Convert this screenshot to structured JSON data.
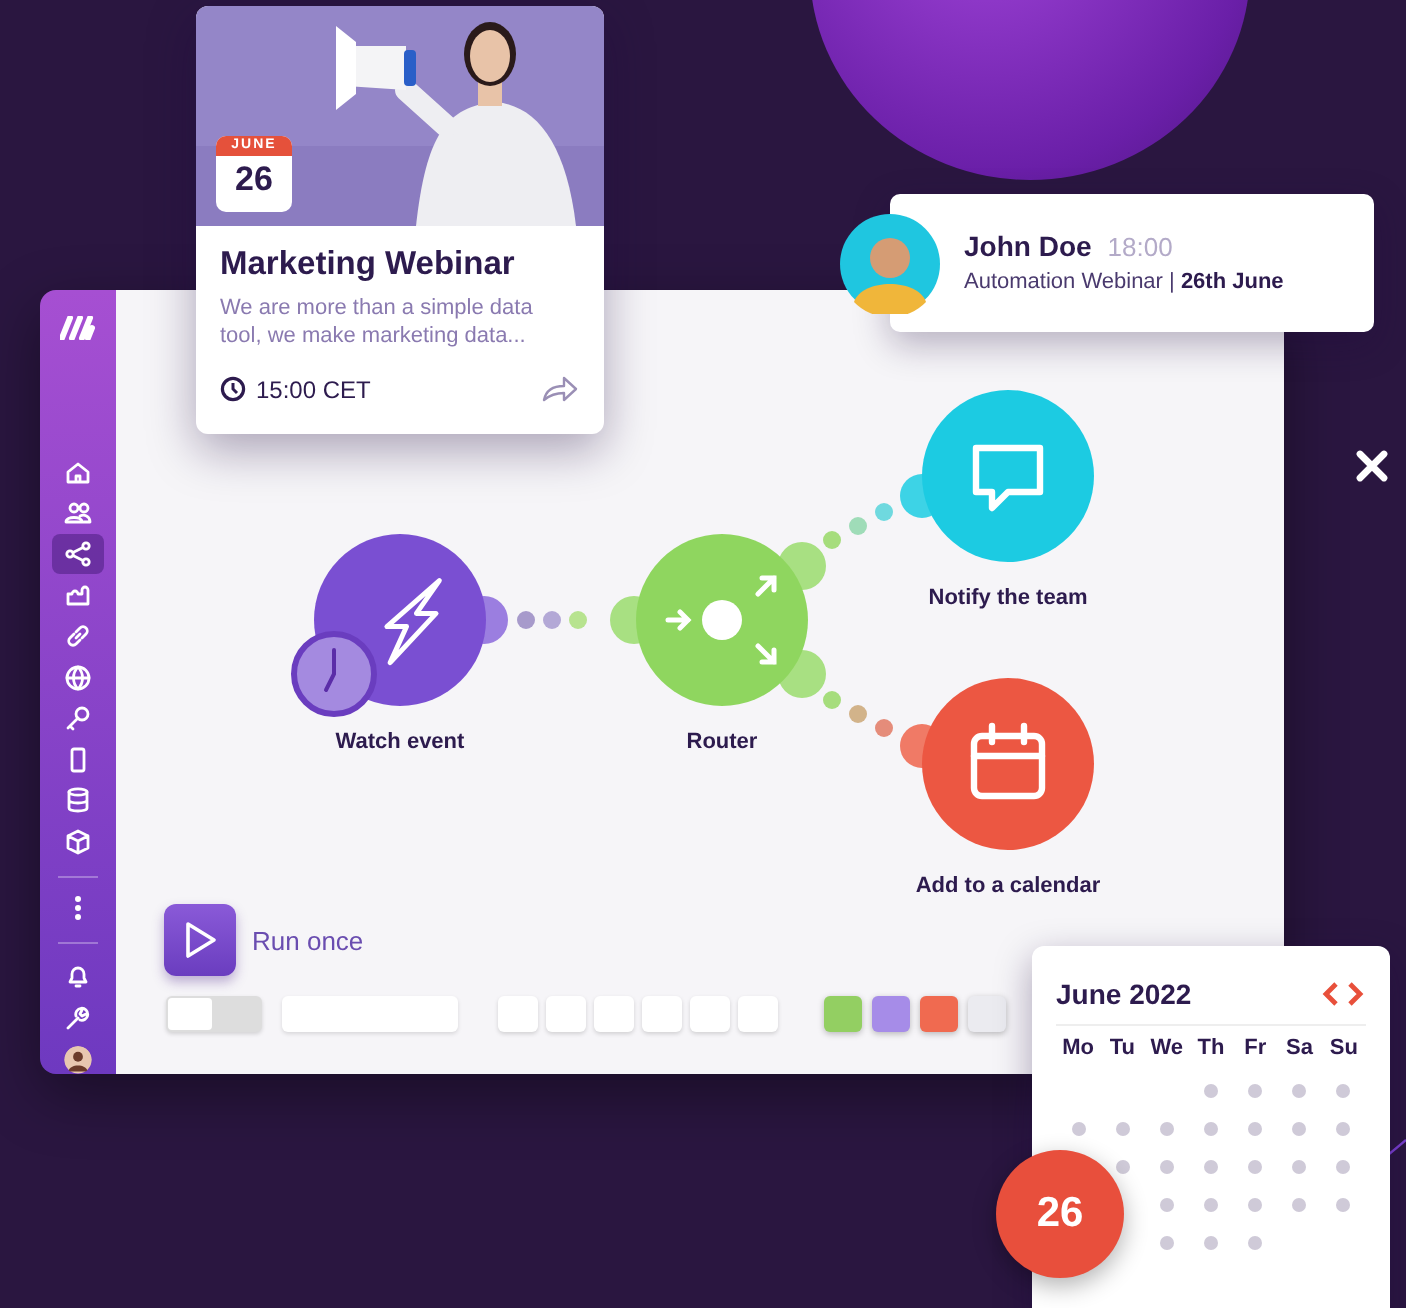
{
  "sidebar": {
    "items": [
      {
        "selected": false
      },
      {
        "selected": false
      },
      {
        "selected": true
      },
      {
        "selected": false
      },
      {
        "selected": false
      },
      {
        "selected": false
      },
      {
        "selected": false
      },
      {
        "selected": false
      },
      {
        "selected": false
      },
      {
        "selected": false
      },
      {
        "selected": false
      },
      {
        "selected": false
      },
      {
        "selected": false
      }
    ]
  },
  "event_card": {
    "month": "JUNE",
    "day": "26",
    "title": "Marketing Webinar",
    "description": "We are more than a simple data tool, we make marketing data...",
    "time": "15:00 CET"
  },
  "notification": {
    "name": "John Doe",
    "time": "18:00",
    "message": "Automation Webinar | **26th June**"
  },
  "scenario": {
    "nodes": [
      {
        "kind": "trigger",
        "label": "Watch event",
        "color": "#7a4fd2"
      },
      {
        "kind": "router",
        "label": "Router",
        "color": "#8fd65f"
      },
      {
        "kind": "message",
        "label": "Notify the team",
        "color": "#1ccbe2"
      },
      {
        "kind": "calendar",
        "label": "Add to a calendar",
        "color": "#ec5742"
      }
    ]
  },
  "run_button": {
    "label": "Run once"
  },
  "toolbar": {
    "toggle": {
      "on": false
    },
    "swatches": [
      {
        "color": "#93cf62"
      },
      {
        "color": "#a68ce8"
      },
      {
        "color": "#f06a50"
      },
      {
        "color": "#ebebf0"
      }
    ]
  },
  "calendar": {
    "title": "June 2022",
    "weekdays": [
      "Mo",
      "Tu",
      "We",
      "Th",
      "Fr",
      "Sa",
      "Su"
    ],
    "highlight_day": "26"
  }
}
